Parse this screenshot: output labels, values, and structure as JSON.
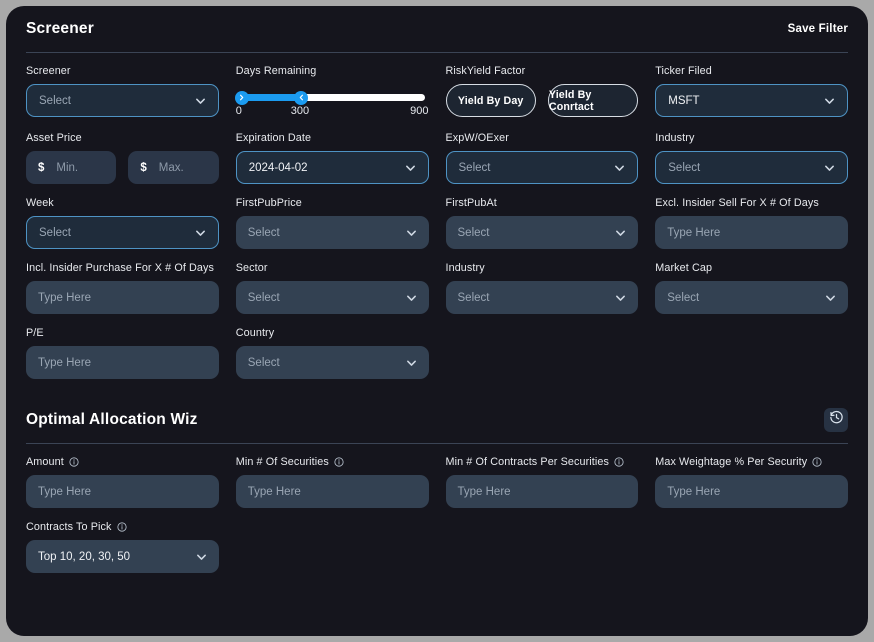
{
  "screener": {
    "title": "Screener",
    "save_label": "Save Filter",
    "fields": {
      "screener": {
        "label": "Screener",
        "value": "Select"
      },
      "days_remaining": {
        "label": "Days Remaining",
        "min_tick": "0",
        "mid_tick": "300",
        "max_tick": "900"
      },
      "riskyield_factor": {
        "label": "RiskYield Factor",
        "option_day": "Yield By Day",
        "option_contract": "Yield By Conrtact"
      },
      "ticker_filed": {
        "label": "Ticker Filed",
        "value": "MSFT"
      },
      "asset_price": {
        "label": "Asset Price",
        "currency": "$",
        "min_placeholder": "Min.",
        "max_placeholder": "Max."
      },
      "expiration_date": {
        "label": "Expiration Date",
        "value": "2024-04-02"
      },
      "expw_oexer": {
        "label": "ExpW/OExer",
        "value": "Select"
      },
      "industry_top": {
        "label": "Industry",
        "value": "Select"
      },
      "week": {
        "label": "Week",
        "value": "Select"
      },
      "firstpubprice": {
        "label": "FirstPubPrice",
        "value": "Select"
      },
      "firstpubat": {
        "label": "FirstPubAt",
        "value": "Select"
      },
      "excl_insider_sell": {
        "label": "Excl. Insider Sell For X # Of Days",
        "value": "Type Here"
      },
      "incl_insider_purchase": {
        "label": "Incl. Insider Purchase For X # Of Days",
        "value": "Type Here"
      },
      "sector": {
        "label": "Sector",
        "value": "Select"
      },
      "industry_bottom": {
        "label": "Industry",
        "value": "Select"
      },
      "market_cap": {
        "label": "Market Cap",
        "value": "Select"
      },
      "pe": {
        "label": "P/E",
        "value": "Type Here"
      },
      "country": {
        "label": "Country",
        "value": "Select"
      }
    }
  },
  "allocation": {
    "title": "Optimal Allocation Wiz",
    "history_icon": "history-icon",
    "fields": {
      "amount": {
        "label": "Amount",
        "value": "Type Here"
      },
      "min_securities": {
        "label": "Min # Of Securities",
        "value": "Type Here"
      },
      "min_contracts": {
        "label": "Min # Of Contracts Per Securities",
        "value": "Type Here"
      },
      "max_weightage": {
        "label": "Max Weightage % Per Security",
        "value": "Type Here"
      },
      "contracts_to_pick": {
        "label": "Contracts To Pick",
        "value": "Top 10, 20, 30, 50"
      }
    }
  },
  "colors": {
    "accent": "#1b9bf0",
    "focus_border": "#4e93c4",
    "card_bg": "#15151d",
    "field_bg": "#334152"
  }
}
